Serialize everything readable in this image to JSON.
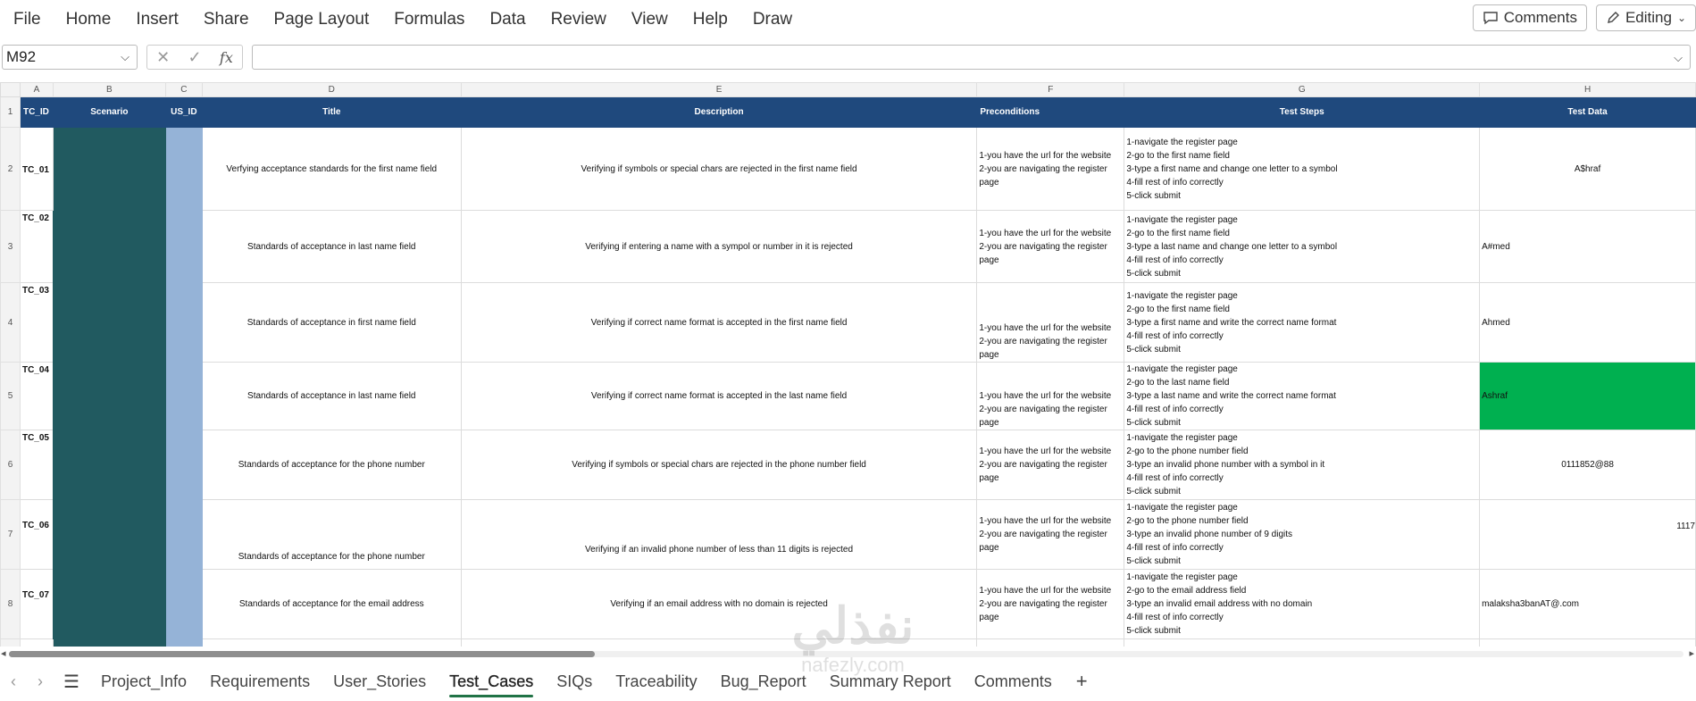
{
  "menu": [
    "File",
    "Home",
    "Insert",
    "Share",
    "Page Layout",
    "Formulas",
    "Data",
    "Review",
    "View",
    "Help",
    "Draw"
  ],
  "top_right": {
    "comments_label": "Comments",
    "editing_label": "Editing"
  },
  "formula_bar": {
    "name_box": "M92",
    "fx": "fx",
    "formula": ""
  },
  "columns": [
    "A",
    "B",
    "C",
    "D",
    "E",
    "F",
    "G",
    "H"
  ],
  "header_row": {
    "row": "1",
    "cells": [
      "TC_ID",
      "Scenario",
      "US_ID",
      "Title",
      "Description",
      "Preconditions",
      "Test Steps",
      "Test Data"
    ]
  },
  "rows": [
    {
      "row": "2",
      "tc_id": "TC_01",
      "title": "Verfying acceptance standards for the first name field",
      "description": "Verifying if symbols or special chars are rejected in the first name field",
      "preconditions": "1-you have the url for the website\n2-you are navigating the register\npage",
      "steps": "1-navigate the register page\n2-go to the first name field\n3-type a first name and change one letter to a symbol\n4-fill rest of info correctly\n5-click submit",
      "test_data": "A$hraf"
    },
    {
      "row": "3",
      "tc_id": "TC_02",
      "title": "Standards of acceptance in last name field",
      "description": "Verifying if entering a name with a sympol or number in it is rejected",
      "preconditions": "1-you have the url for the website\n2-you are navigating the register\npage",
      "steps": "1-navigate the register page\n2-go to the first name field\n3-type a last name and change one letter to a symbol\n4-fill rest of info correctly\n5-click submit",
      "test_data": "A#med"
    },
    {
      "row": "4",
      "tc_id": "TC_03",
      "title": "Standards of acceptance in first name field",
      "description": "Verifying if correct name format is accepted in the first name field",
      "preconditions": "1-you have the url for the website\n2-you are navigating the register\npage",
      "steps": "1-navigate the register page\n2-go to the first name field\n3-type a first name and write the correct name format\n4-fill rest of info correctly\n5-click submit",
      "test_data": "Ahmed"
    },
    {
      "row": "5",
      "tc_id": "TC_04",
      "title": "Standards of acceptance in last name field",
      "description": "Verifying if correct name format is accepted in the last name field",
      "preconditions": "1-you have the url for the website\n2-you are navigating the register\npage",
      "steps": "1-navigate the register page\n2-go to the last name field\n3-type a last name and write the correct name format\n4-fill rest of info correctly\n5-click submit",
      "test_data": "Ashraf"
    },
    {
      "row": "6",
      "tc_id": "TC_05",
      "title": "Standards of acceptance for the phone number",
      "description": "Verifying if symbols or special chars are rejected in the phone number field",
      "preconditions": "1-you have the url for the website\n2-you are navigating the register\npage",
      "steps": "1-navigate the register page\n2-go to the phone number field\n3-type an invalid phone number with a symbol in it\n4-fill rest of info correctly\n5-click submit",
      "test_data": "0111852@88"
    },
    {
      "row": "7",
      "tc_id": "TC_06",
      "title": "Standards of acceptance for the phone number",
      "description": "Verifying if an invalid phone number of less than 11 digits is rejected",
      "preconditions": "1-you have the url for the website\n2-you are navigating the register\npage",
      "steps": "1-navigate the register page\n2-go to the phone number field\n3-type an invalid phone number of 9 digits\n4-fill rest of info correctly\n5-click submit",
      "test_data": "1117"
    },
    {
      "row": "8",
      "tc_id": "TC_07",
      "title": "Standards of acceptance for the email address",
      "description": "Verifying if an email address with no domain is rejected",
      "preconditions": "1-you have the url for the website\n2-you are navigating the register\npage",
      "steps": "1-navigate the register page\n2-go to the email address field\n3-type an invalid email address with no domain\n4-fill rest of info correctly\n5-click submit",
      "test_data": "malaksha3banAT@.com"
    }
  ],
  "sheet_tabs": [
    "Project_Info",
    "Requirements",
    "User_Stories",
    "Test_Cases",
    "SIQs",
    "Traceability",
    "Bug_Report",
    "Summary Report",
    "Comments"
  ],
  "active_tab": "Test_Cases",
  "watermark": {
    "arabic": "نفذلي",
    "latin": "nafezly.com"
  },
  "colors": {
    "header_blue": "#1f497d",
    "scenario_teal": "#215a60",
    "usid_blue": "#95b3d7",
    "highlight_green": "#00b050",
    "active_tab_underline": "#217346"
  }
}
